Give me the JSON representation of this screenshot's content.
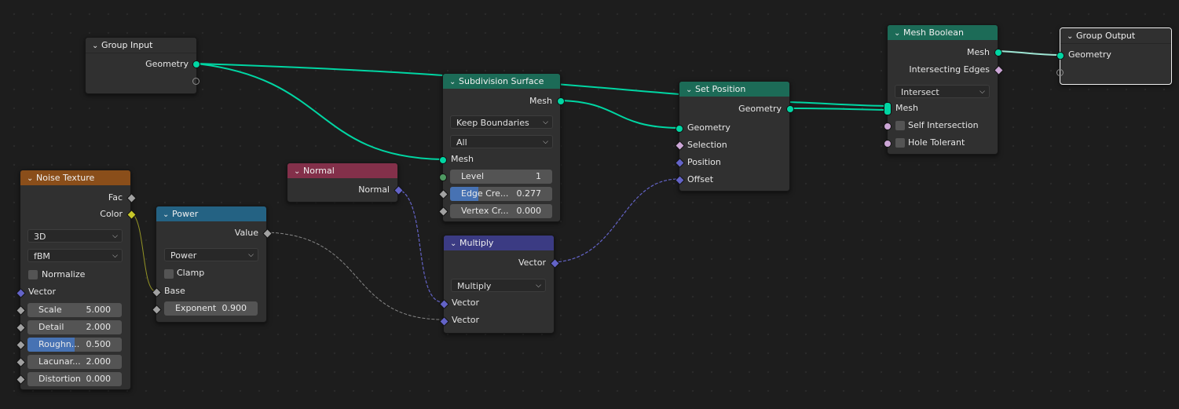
{
  "colors": {
    "geometry_socket": "#00d6a3",
    "vector_socket": "#6363c7",
    "float_socket": "#a1a1a1",
    "color_socket": "#c7c729",
    "boolean_socket": "#cca6d6",
    "geometry_header": "#1c6b57",
    "texture_header": "#8a4e1a",
    "input_header": "#83304a",
    "math_header": "#246283",
    "vector_header": "#3b3b83",
    "field_fill": "#4772b3"
  },
  "nodes": {
    "group_input": {
      "title": "Group Input",
      "outputs": [
        "Geometry"
      ]
    },
    "noise_texture": {
      "title": "Noise Texture",
      "outputs": [
        "Fac",
        "Color"
      ],
      "dimensions": "3D",
      "type": "fBM",
      "normalize_label": "Normalize",
      "inputs": {
        "vector": "Vector",
        "scale": {
          "label": "Scale",
          "value": "5.000"
        },
        "detail": {
          "label": "Detail",
          "value": "2.000"
        },
        "roughness": {
          "label": "Roughn...",
          "value": "0.500",
          "level": 0.5
        },
        "lacunarity": {
          "label": "Lacunar...",
          "value": "2.000"
        },
        "distortion": {
          "label": "Distortion",
          "value": "0.000"
        }
      }
    },
    "power": {
      "title": "Power",
      "output": "Value",
      "operation": "Power",
      "clamp_label": "Clamp",
      "base_label": "Base",
      "exponent": {
        "label": "Exponent",
        "value": "0.900"
      }
    },
    "normal": {
      "title": "Normal",
      "output": "Normal"
    },
    "subdivision_surface": {
      "title": "Subdivision Surface",
      "output": "Mesh",
      "boundary": "Keep Boundaries",
      "uv_smooth": "All",
      "input_mesh": "Mesh",
      "level": {
        "label": "Level",
        "value": "1"
      },
      "edge_crease": {
        "label": "Edge Cre...",
        "value": "0.277",
        "level": 0.277
      },
      "vertex_crease": {
        "label": "Vertex Cr...",
        "value": "0.000"
      }
    },
    "multiply": {
      "title": "Multiply",
      "output": "Vector",
      "operation": "Multiply",
      "input1": "Vector",
      "input2": "Vector"
    },
    "set_position": {
      "title": "Set Position",
      "output": "Geometry",
      "inputs": [
        "Geometry",
        "Selection",
        "Position",
        "Offset"
      ]
    },
    "mesh_boolean": {
      "title": "Mesh Boolean",
      "outputs": [
        "Mesh",
        "Intersecting Edges"
      ],
      "operation": "Intersect",
      "input_mesh": "Mesh",
      "self_intersection": "Self Intersection",
      "hole_tolerant": "Hole Tolerant"
    },
    "group_output": {
      "title": "Group Output",
      "input": "Geometry"
    }
  }
}
